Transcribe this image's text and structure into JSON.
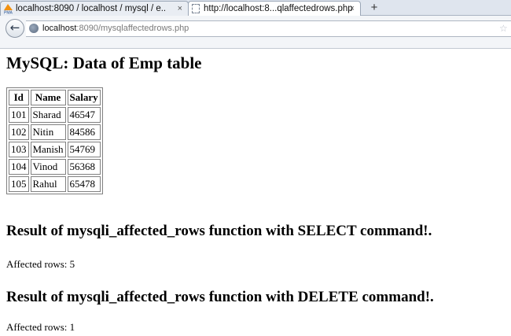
{
  "browser": {
    "tabs": [
      {
        "label": "localhost:8090 / localhost / mysql / e...",
        "close": "×",
        "icon": "phpmyadmin-icon"
      },
      {
        "label": "http://localhost:8...qlaffectedrows.php",
        "close": "×",
        "icon": "page-icon"
      }
    ],
    "new_tab": "+",
    "back": "←",
    "url": {
      "host": "localhost",
      "rest": ":8090/mysqlaffectedrows.php",
      "star": "☆"
    }
  },
  "page": {
    "title": "MySQL: Data of Emp table",
    "table": {
      "headers": [
        "Id",
        "Name",
        "Salary"
      ],
      "rows": [
        [
          "101",
          "Sharad",
          "46547"
        ],
        [
          "102",
          "Nitin",
          "84586"
        ],
        [
          "103",
          "Manish",
          "54769"
        ],
        [
          "104",
          "Vinod",
          "56368"
        ],
        [
          "105",
          "Rahul",
          "65478"
        ]
      ]
    },
    "select_heading": "Result of mysqli_affected_rows function with SELECT command!.",
    "select_result": "Affected rows: 5",
    "delete_heading": "Result of mysqli_affected_rows function with DELETE command!.",
    "delete_result": "Affected rows: 1"
  }
}
